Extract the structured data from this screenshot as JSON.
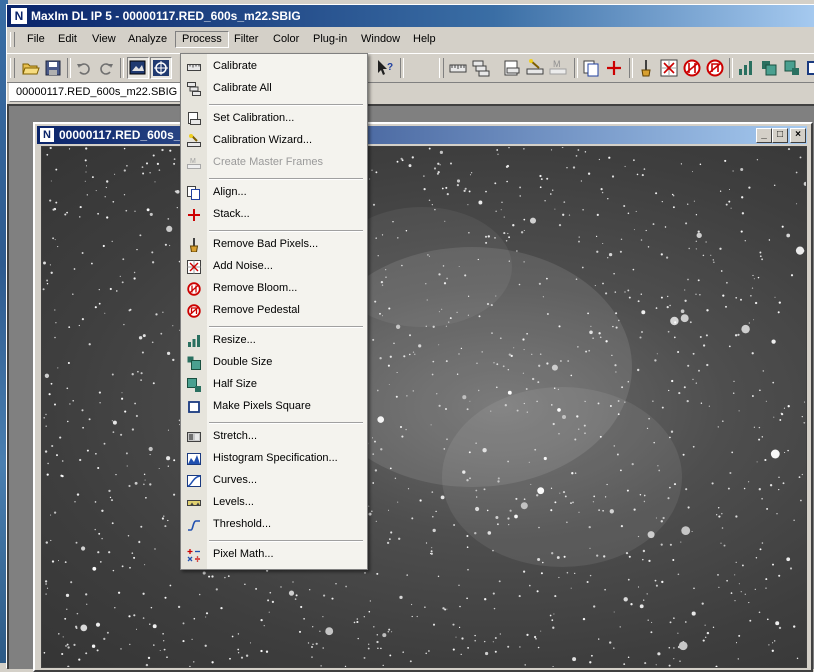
{
  "window": {
    "title": "MaxIm DL IP 5 - 00000117.RED_600s_m22.SBIG",
    "icon": "app-logo-icon"
  },
  "menubar": {
    "items": [
      {
        "label": "File"
      },
      {
        "label": "Edit"
      },
      {
        "label": "View"
      },
      {
        "label": "Analyze"
      },
      {
        "label": "Process",
        "active": true
      },
      {
        "label": "Filter"
      },
      {
        "label": "Color"
      },
      {
        "label": "Plug-in"
      },
      {
        "label": "Window"
      },
      {
        "label": "Help"
      }
    ]
  },
  "toolbar": {
    "icons": [
      "open-icon",
      "save-icon",
      "undo-icon",
      "redo-icon",
      "screen-stretch-icon",
      "crosshair-icon",
      "help-pointer-icon",
      "calibrate-icon",
      "calibrate-all-icon",
      "set-calibration-icon",
      "calibration-wizard-icon",
      "master-frames-icon",
      "align-icon",
      "stack-icon",
      "bad-pixels-icon",
      "add-noise-icon",
      "remove-bloom-icon",
      "remove-pedestal-icon",
      "resize-icon",
      "double-size-icon",
      "half-size-icon",
      "square-pixels-icon"
    ]
  },
  "doc_tab": {
    "label": "00000117.RED_600s_m22.SBIG"
  },
  "child_window": {
    "title": "00000117.RED_600s_m22.SBIG",
    "minimize": "_",
    "maximize": "□",
    "close": "×"
  },
  "process_menu": {
    "items": [
      {
        "label": "Calibrate",
        "icon": "calibrate-icon",
        "enabled": true
      },
      {
        "label": "Calibrate All",
        "icon": "calibrate-all-icon",
        "enabled": true
      },
      {
        "label": "Set Calibration...",
        "icon": "set-calibration-icon",
        "enabled": true
      },
      {
        "label": "Calibration Wizard...",
        "icon": "calibration-wizard-icon",
        "enabled": true
      },
      {
        "label": "Create Master Frames",
        "icon": "master-frames-icon",
        "enabled": false
      },
      {
        "label": "Align...",
        "icon": "align-icon",
        "enabled": true
      },
      {
        "label": "Stack...",
        "icon": "stack-icon",
        "enabled": true
      },
      {
        "label": "Remove Bad Pixels...",
        "icon": "bad-pixels-icon",
        "enabled": true
      },
      {
        "label": "Add Noise...",
        "icon": "add-noise-icon",
        "enabled": true
      },
      {
        "label": "Remove Bloom...",
        "icon": "remove-bloom-icon",
        "enabled": true
      },
      {
        "label": "Remove Pedestal",
        "icon": "remove-pedestal-icon",
        "enabled": true
      },
      {
        "label": "Resize...",
        "icon": "resize-icon",
        "enabled": true
      },
      {
        "label": "Double Size",
        "icon": "double-size-icon",
        "enabled": true
      },
      {
        "label": "Half Size",
        "icon": "half-size-icon",
        "enabled": true
      },
      {
        "label": "Make Pixels Square",
        "icon": "square-pixels-icon",
        "enabled": true
      },
      {
        "label": "Stretch...",
        "icon": "stretch-icon",
        "enabled": true
      },
      {
        "label": "Histogram Specification...",
        "icon": "histogram-icon",
        "enabled": true
      },
      {
        "label": "Curves...",
        "icon": "curves-icon",
        "enabled": true
      },
      {
        "label": "Levels...",
        "icon": "levels-icon",
        "enabled": true
      },
      {
        "label": "Threshold...",
        "icon": "threshold-icon",
        "enabled": true
      },
      {
        "label": "Pixel Math...",
        "icon": "pixel-math-icon",
        "enabled": true
      }
    ]
  },
  "colors": {
    "title_active": "#0a246a",
    "title_gradient_end": "#a6caf0",
    "face": "#d4d0c8",
    "menu_bg": "#f4f3ee",
    "stack_red": "#cc0000"
  }
}
